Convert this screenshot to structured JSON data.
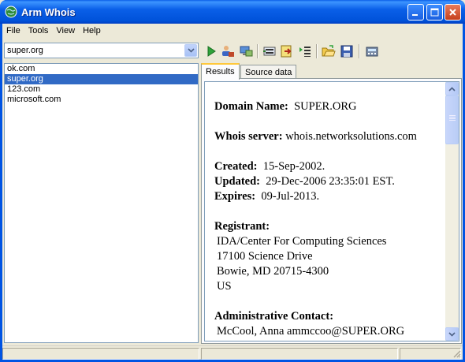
{
  "window": {
    "title": "Arm Whois"
  },
  "menu": [
    {
      "label": "File"
    },
    {
      "label": "Tools"
    },
    {
      "label": "View"
    },
    {
      "label": "Help"
    }
  ],
  "toolbar": {
    "domain_input": "super.org",
    "icons": [
      "run-icon",
      "user-lookup-icon",
      "network-icon",
      "server-icon",
      "export-icon",
      "list-icon",
      "open-folder-icon",
      "save-icon",
      "calculator-icon"
    ]
  },
  "domains": [
    "ok.com",
    "super.org",
    "123.com",
    "microsoft.com"
  ],
  "selected_domain_index": 1,
  "tabs": [
    {
      "label": "Results"
    },
    {
      "label": "Source data"
    }
  ],
  "results": {
    "domain_name_label": "Domain Name:",
    "domain_name": "SUPER.ORG",
    "whois_server_label": "Whois server:",
    "whois_server": "whois.networksolutions.com",
    "created_label": "Created:",
    "created": "15-Sep-2002.",
    "updated_label": "Updated:",
    "updated": "29-Dec-2006 23:35:01 EST.",
    "expires_label": "Expires:",
    "expires": "09-Jul-2013.",
    "registrant_label": "Registrant:",
    "registrant_lines": [
      "IDA/Center For Computing Sciences",
      "17100 Science Drive",
      "Bowie, MD 20715-4300",
      "US"
    ],
    "admin_label": "Administrative Contact:",
    "admin_line": "McCool, Anna ammccoo@SUPER.ORG"
  },
  "colors": {
    "title_bar": "#0a5fe8",
    "selection": "#316ac5",
    "tab_highlight": "#ffc83c"
  }
}
